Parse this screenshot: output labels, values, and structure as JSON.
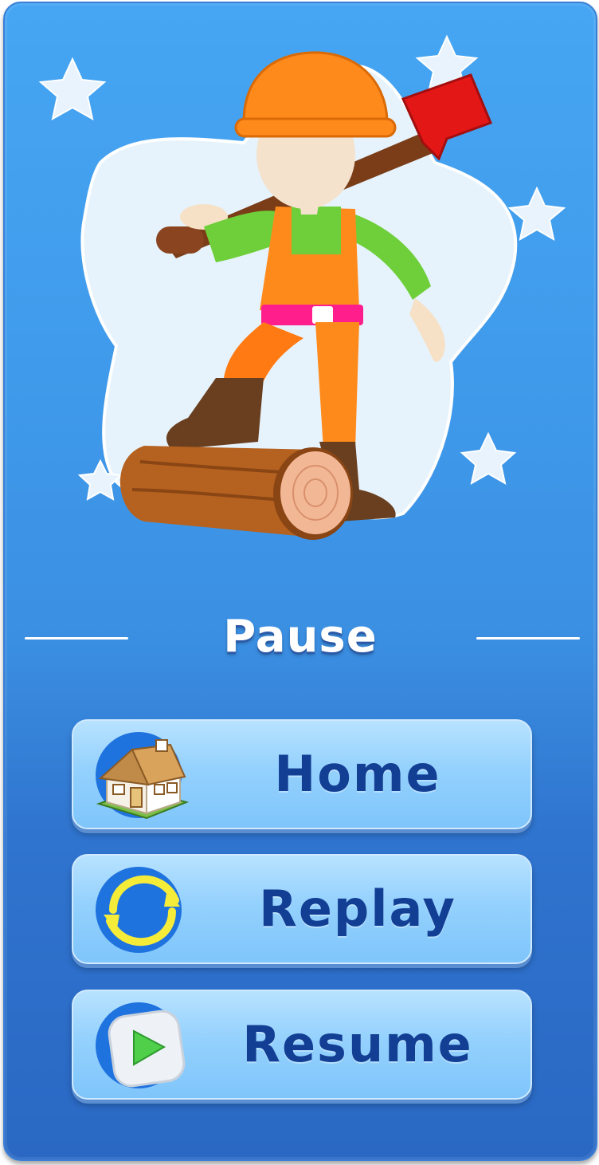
{
  "pause_menu": {
    "title": "Pause",
    "buttons": [
      {
        "label": "Home",
        "icon": "house-icon"
      },
      {
        "label": "Replay",
        "icon": "replay-icon"
      },
      {
        "label": "Resume",
        "icon": "play-icon"
      }
    ]
  },
  "hero": {
    "character": "lumberjack-with-axe-on-log"
  },
  "colors": {
    "panel_top": "#46a6f3",
    "panel_bottom": "#2a68c3",
    "button": "#94d1fd",
    "button_text": "#123e94",
    "title_text": "#ffffff"
  }
}
